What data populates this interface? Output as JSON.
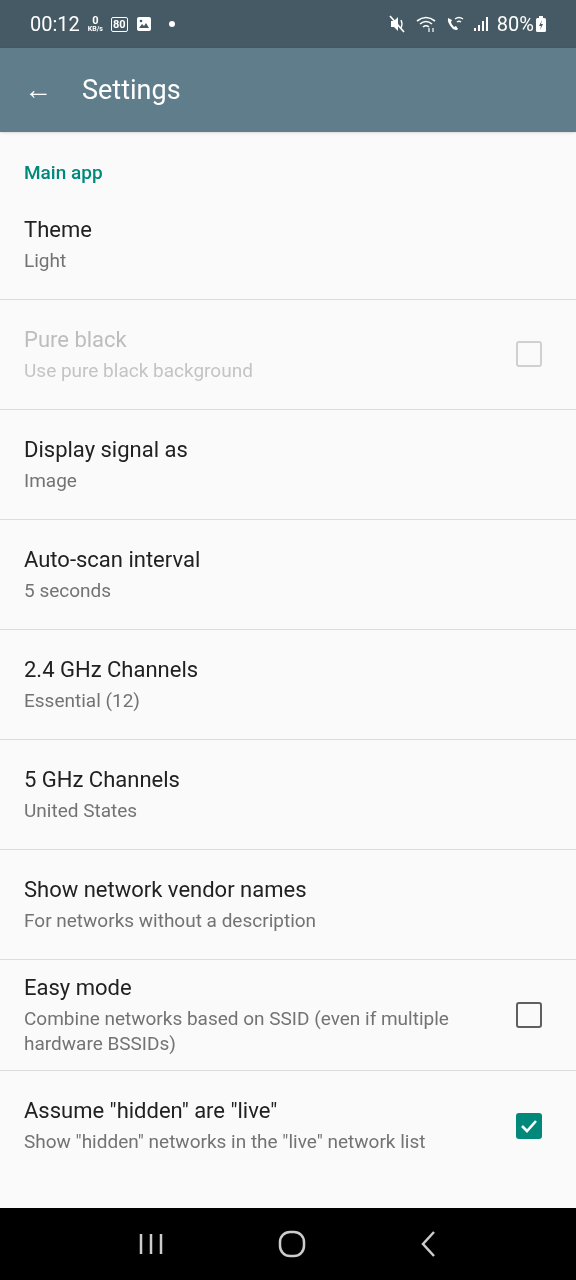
{
  "status_bar": {
    "time": "00:12",
    "speed_value": "0",
    "speed_unit": "KB/s",
    "badge": "80",
    "battery": "80%"
  },
  "app_bar": {
    "back": "←",
    "title": "Settings"
  },
  "category": "Main app",
  "items": [
    {
      "kind": "text",
      "title": "Theme",
      "summary": "Light",
      "disabled": false
    },
    {
      "kind": "checkbox",
      "title": "Pure black",
      "summary": "Use pure black background",
      "disabled": true,
      "checked": false
    },
    {
      "kind": "text",
      "title": "Display signal as",
      "summary": "Image",
      "disabled": false
    },
    {
      "kind": "text",
      "title": "Auto-scan interval",
      "summary": "5 seconds",
      "disabled": false
    },
    {
      "kind": "text",
      "title": "2.4 GHz Channels",
      "summary": "Essential (12)",
      "disabled": false
    },
    {
      "kind": "text",
      "title": "5 GHz Channels",
      "summary": "United States",
      "disabled": false
    },
    {
      "kind": "text",
      "title": "Show network vendor names",
      "summary": "For networks without a description",
      "disabled": false
    },
    {
      "kind": "checkbox",
      "title": "Easy mode",
      "summary": "Combine networks based on SSID (even if multiple hardware BSSIDs)",
      "disabled": false,
      "checked": false
    },
    {
      "kind": "checkbox",
      "title": "Assume \"hidden\" are \"live\"",
      "summary": "Show \"hidden\" networks in the \"live\" network list",
      "disabled": false,
      "checked": true
    }
  ]
}
